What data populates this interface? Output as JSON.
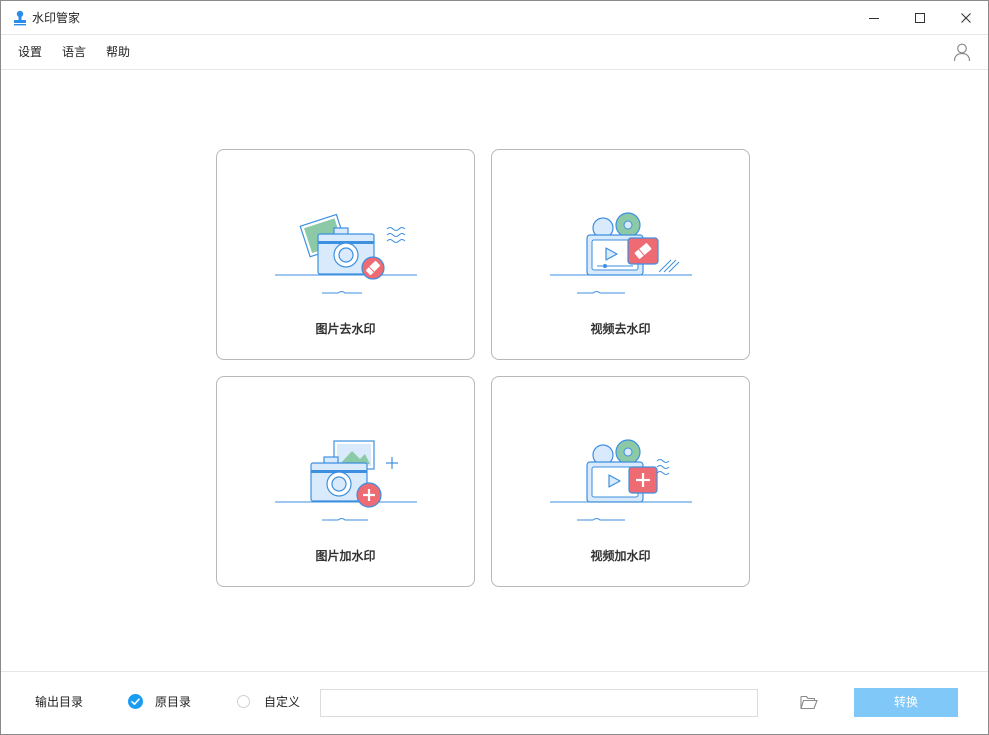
{
  "window": {
    "title": "水印管家"
  },
  "menu": {
    "settings": "设置",
    "language": "语言",
    "help": "帮助"
  },
  "cards": [
    {
      "label": "图片去水印",
      "icon": "photo-remove-watermark-icon"
    },
    {
      "label": "视频去水印",
      "icon": "video-remove-watermark-icon"
    },
    {
      "label": "图片加水印",
      "icon": "photo-add-watermark-icon"
    },
    {
      "label": "视频加水印",
      "icon": "video-add-watermark-icon"
    }
  ],
  "output": {
    "label": "输出目录",
    "option_original": "原目录",
    "option_custom": "自定义",
    "selected": "原目录",
    "path_value": "",
    "convert_label": "转换"
  },
  "colors": {
    "accent": "#1a9cf0",
    "convert_button": "#80c8f8",
    "illustration_blue": "#3d8fe0",
    "illustration_light": "#d8eafb",
    "illustration_red": "#ef6b73",
    "illustration_green": "#8cc9a6"
  }
}
